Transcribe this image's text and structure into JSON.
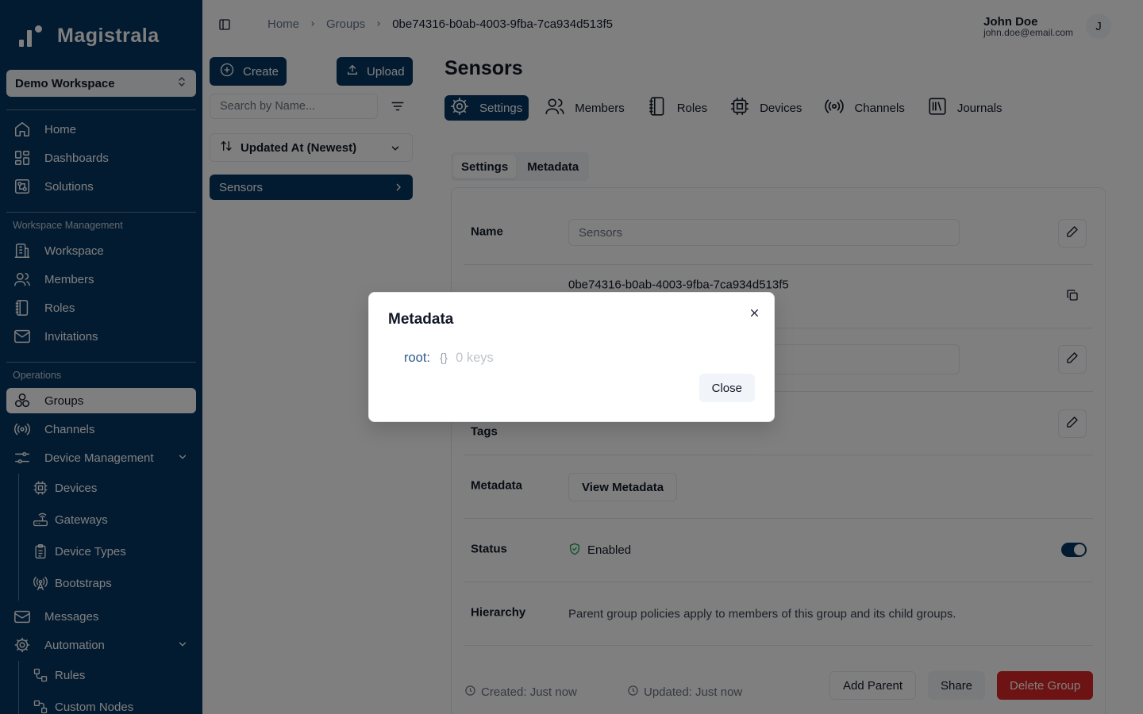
{
  "app": {
    "name": "Magistrala"
  },
  "workspace": {
    "selected": "Demo Workspace"
  },
  "sidebar": {
    "top_items": [
      {
        "label": "Home",
        "icon": "home-icon"
      },
      {
        "label": "Dashboards",
        "icon": "dashboards-icon"
      },
      {
        "label": "Solutions",
        "icon": "solutions-icon"
      }
    ],
    "workspace_section": "Workspace Management",
    "workspace_items": [
      {
        "label": "Workspace",
        "icon": "building-icon"
      },
      {
        "label": "Members",
        "icon": "users-icon"
      },
      {
        "label": "Roles",
        "icon": "notebook-icon"
      },
      {
        "label": "Invitations",
        "icon": "mail-icon"
      }
    ],
    "operations_section": "Operations",
    "operations_items": [
      {
        "label": "Groups",
        "icon": "groups-icon",
        "active": true
      },
      {
        "label": "Channels",
        "icon": "radio-icon"
      },
      {
        "label": "Device Management",
        "icon": "sliders-icon"
      }
    ],
    "device_sub_items": [
      {
        "label": "Devices",
        "icon": "chip-icon"
      },
      {
        "label": "Gateways",
        "icon": "router-icon"
      },
      {
        "label": "Device Types",
        "icon": "clipboard-icon"
      },
      {
        "label": "Bootstraps",
        "icon": "antenna-icon"
      }
    ],
    "messages": "Messages",
    "automation": "Automation",
    "automation_sub_items": [
      {
        "label": "Rules",
        "icon": "rules-icon"
      },
      {
        "label": "Custom Nodes",
        "icon": "nodes-icon"
      }
    ]
  },
  "breadcrumb": {
    "home": "Home",
    "groups": "Groups",
    "current": "0be74316-b0ab-4003-9fba-7ca934d513f5"
  },
  "user": {
    "name": "John Doe",
    "email": "john.doe@email.com",
    "initial": "J"
  },
  "list_panel": {
    "create_label": "Create",
    "upload_label": "Upload",
    "search_placeholder": "Search by Name...",
    "sort_label": "Updated At (Newest)",
    "items": [
      "Sensors"
    ]
  },
  "page": {
    "title": "Sensors",
    "tabs": [
      "Settings",
      "Members",
      "Roles",
      "Devices",
      "Channels",
      "Journals"
    ],
    "subtabs": [
      "Settings",
      "Metadata"
    ]
  },
  "settings": {
    "name_label": "Name",
    "name_value": "Sensors",
    "id_value": "0be74316-b0ab-4003-9fba-7ca934d513f5",
    "tags_label": "Tags",
    "metadata_label": "Metadata",
    "view_metadata": "View Metadata",
    "status_label": "Status",
    "status_value": "Enabled",
    "hierarchy_label": "Hierarchy",
    "hierarchy_value": "Parent group policies apply to members of this group and its child groups.",
    "created": "Created: Just now",
    "updated": "Updated: Just now",
    "add_parent": "Add Parent",
    "share": "Share",
    "delete_group": "Delete Group"
  },
  "modal": {
    "title": "Metadata",
    "json_key": "root:",
    "json_brace": "{}",
    "json_count": "0 keys",
    "close_label": "Close"
  },
  "colors": {
    "brand": "#073763",
    "danger": "#dc2626",
    "status_ok": "#16a34a"
  }
}
